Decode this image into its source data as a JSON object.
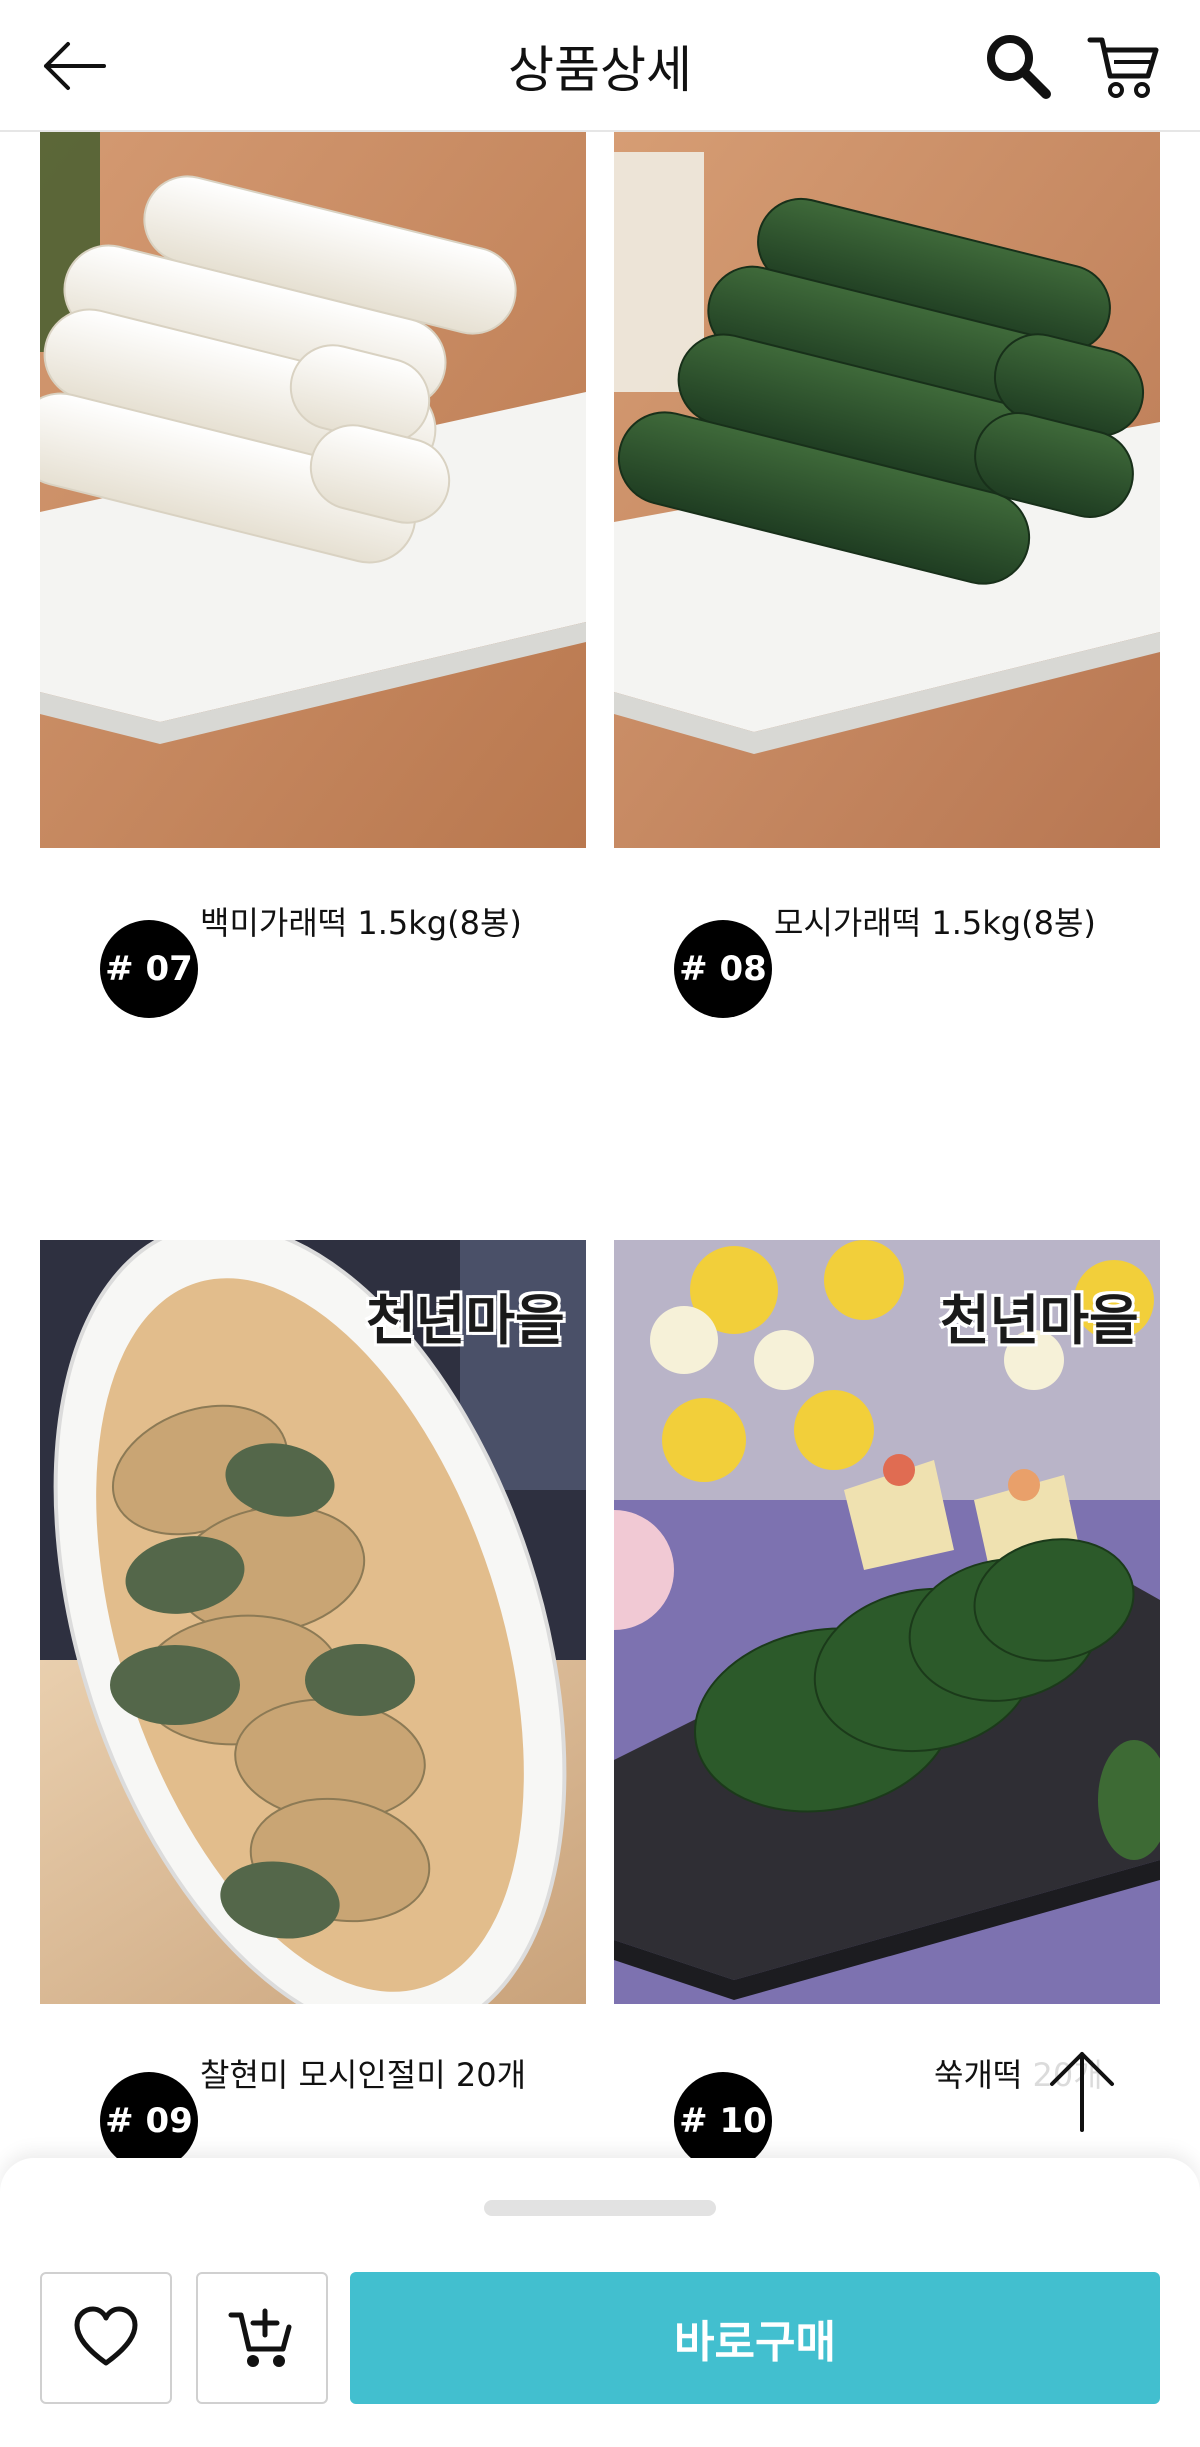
{
  "header": {
    "title": "상품상세",
    "back_icon": "back-arrow-icon",
    "search_icon": "search-icon",
    "cart_icon": "cart-icon"
  },
  "products": [
    {
      "number": "# 07",
      "name": "백미가래떡 1.5kg(8봉)"
    },
    {
      "number": "# 08",
      "name": "모시가래떡 1.5kg(8봉)"
    },
    {
      "number": "# 09",
      "name": "찰현미 모시인절미 20개",
      "logo": "천년마을"
    },
    {
      "number": "# 10",
      "name": "쑥개떡 20개",
      "logo": "천년마을"
    }
  ],
  "bottom_bar": {
    "wishlist_icon": "heart-icon",
    "add_to_cart_icon": "add-to-cart-icon",
    "buy_label": "바로구매"
  },
  "colors": {
    "accent": "#42bfcf",
    "badge": "#000000"
  }
}
